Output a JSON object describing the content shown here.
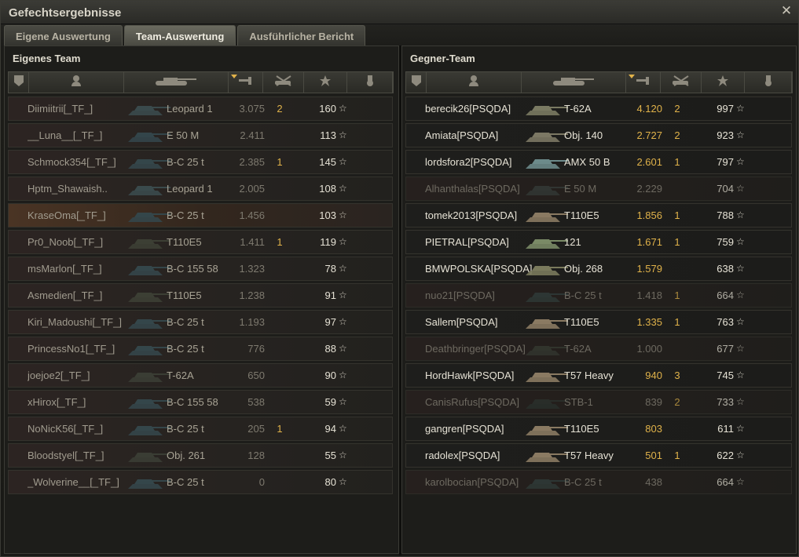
{
  "window": {
    "title": "Gefechtsergebnisse"
  },
  "tabs": [
    {
      "label": "Eigene Auswertung",
      "active": false
    },
    {
      "label": "Team-Auswertung",
      "active": true
    },
    {
      "label": "Ausführlicher Bericht",
      "active": false
    }
  ],
  "columns": [
    "squad-icon",
    "player-icon",
    "tank-icon",
    "experience-icon",
    "kills-icon",
    "score-icon",
    "medal-icon"
  ],
  "own_team": {
    "title": "Eigenes Team",
    "players": [
      {
        "name": "Diimiitrii[_TF_]",
        "tank": "Leopard 1",
        "xp": "3.075",
        "kills": "2",
        "score": "160",
        "dead": false,
        "self": false,
        "tank_color": "#3a4a4c"
      },
      {
        "name": "__Luna__[_TF_]",
        "tank": "E 50 M",
        "xp": "2.411",
        "kills": "",
        "score": "113",
        "dead": false,
        "self": false,
        "tank_color": "#33454a"
      },
      {
        "name": "Schmock354[_TF_]",
        "tank": "B-C 25 t",
        "xp": "2.385",
        "kills": "1",
        "score": "145",
        "dead": false,
        "self": false,
        "tank_color": "#34464a"
      },
      {
        "name": "Hptm_Shawaish..",
        "tank": "Leopard 1",
        "xp": "2.005",
        "kills": "",
        "score": "108",
        "dead": false,
        "self": false,
        "tank_color": "#3a4a4c"
      },
      {
        "name": "KraseOma[_TF_]",
        "tank": "B-C 25 t",
        "xp": "1.456",
        "kills": "",
        "score": "103",
        "dead": false,
        "self": true,
        "tank_color": "#34464a"
      },
      {
        "name": "Pr0_Noob[_TF_]",
        "tank": "T110E5",
        "xp": "1.411",
        "kills": "1",
        "score": "119",
        "dead": false,
        "self": false,
        "tank_color": "#3c3f34"
      },
      {
        "name": "msMarlon[_TF_]",
        "tank": "B-C 155 58",
        "xp": "1.323",
        "kills": "",
        "score": "78",
        "dead": false,
        "self": false,
        "tank_color": "#34464a"
      },
      {
        "name": "Asmedien[_TF_]",
        "tank": "T110E5",
        "xp": "1.238",
        "kills": "",
        "score": "91",
        "dead": false,
        "self": false,
        "tank_color": "#3c3f34"
      },
      {
        "name": "Kiri_Madoushi[_TF_]",
        "tank": "B-C 25 t",
        "xp": "1.193",
        "kills": "",
        "score": "97",
        "dead": false,
        "self": false,
        "tank_color": "#34464a"
      },
      {
        "name": "PrincessNo1[_TF_]",
        "tank": "B-C 25 t",
        "xp": "776",
        "kills": "",
        "score": "88",
        "dead": false,
        "self": false,
        "tank_color": "#34464a"
      },
      {
        "name": "joejoe2[_TF_]",
        "tank": "T-62A",
        "xp": "650",
        "kills": "",
        "score": "90",
        "dead": false,
        "self": false,
        "tank_color": "#3a3d34"
      },
      {
        "name": "xHirox[_TF_]",
        "tank": "B-C 155 58",
        "xp": "538",
        "kills": "",
        "score": "59",
        "dead": false,
        "self": false,
        "tank_color": "#34464a"
      },
      {
        "name": "NoNicK56[_TF_]",
        "tank": "B-C 25 t",
        "xp": "205",
        "kills": "1",
        "score": "94",
        "dead": false,
        "self": false,
        "tank_color": "#34464a"
      },
      {
        "name": "Bloodstyel[_TF_]",
        "tank": "Obj. 261",
        "xp": "128",
        "kills": "",
        "score": "55",
        "dead": false,
        "self": false,
        "tank_color": "#3a3d34"
      },
      {
        "name": "_Wolverine__[_TF_]",
        "tank": "B-C 25 t",
        "xp": "0",
        "kills": "",
        "score": "80",
        "dead": false,
        "self": false,
        "tank_color": "#34464a"
      }
    ]
  },
  "enemy_team": {
    "title": "Gegner-Team",
    "players": [
      {
        "name": "berecik26[PSQDA]",
        "tank": "T-62A",
        "xp": "4.120",
        "kills": "2",
        "score": "997",
        "dead": false,
        "tank_color": "#7a7a62"
      },
      {
        "name": "Amiata[PSQDA]",
        "tank": "Obj. 140",
        "xp": "2.727",
        "kills": "2",
        "score": "923",
        "dead": false,
        "tank_color": "#7c7864"
      },
      {
        "name": "lordsfora2[PSQDA]",
        "tank": "AMX 50 B",
        "xp": "2.601",
        "kills": "1",
        "score": "797",
        "dead": false,
        "tank_color": "#6c8a8a"
      },
      {
        "name": "Alhanthalas[PSQDA]",
        "tank": "E 50 M",
        "xp": "2.229",
        "kills": "",
        "score": "704",
        "dead": true,
        "tank_color": "#3a3f3c"
      },
      {
        "name": "tomek2013[PSQDA]",
        "tank": "T110E5",
        "xp": "1.856",
        "kills": "1",
        "score": "788",
        "dead": false,
        "tank_color": "#8a7a62"
      },
      {
        "name": "PIETRAL[PSQDA]",
        "tank": "121",
        "xp": "1.671",
        "kills": "1",
        "score": "759",
        "dead": false,
        "tank_color": "#7a8a66"
      },
      {
        "name": "BMWPOLSKA[PSQDA]",
        "tank": "Obj. 268",
        "xp": "1.579",
        "kills": "",
        "score": "638",
        "dead": false,
        "tank_color": "#7a7a5c"
      },
      {
        "name": "nuo21[PSQDA]",
        "tank": "B-C 25 t",
        "xp": "1.418",
        "kills": "1",
        "score": "664",
        "dead": true,
        "tank_color": "#34403e"
      },
      {
        "name": "Sallem[PSQDA]",
        "tank": "T110E5",
        "xp": "1.335",
        "kills": "1",
        "score": "763",
        "dead": false,
        "tank_color": "#8a7a62"
      },
      {
        "name": "Deathbringer[PSQDA]",
        "tank": "T-62A",
        "xp": "1.000",
        "kills": "",
        "score": "677",
        "dead": true,
        "tank_color": "#3a3d34"
      },
      {
        "name": "HordHawk[PSQDA]",
        "tank": "T57 Heavy",
        "xp": "940",
        "kills": "3",
        "score": "745",
        "dead": false,
        "tank_color": "#8a7a62"
      },
      {
        "name": "CanisRufus[PSQDA]",
        "tank": "STB-1",
        "xp": "839",
        "kills": "2",
        "score": "733",
        "dead": true,
        "tank_color": "#2e3430"
      },
      {
        "name": "gangren[PSQDA]",
        "tank": "T110E5",
        "xp": "803",
        "kills": "",
        "score": "611",
        "dead": false,
        "tank_color": "#8a7a62"
      },
      {
        "name": "radolex[PSQDA]",
        "tank": "T57 Heavy",
        "xp": "501",
        "kills": "1",
        "score": "622",
        "dead": false,
        "tank_color": "#8a7a62"
      },
      {
        "name": "karolbocian[PSQDA]",
        "tank": "B-C 25 t",
        "xp": "438",
        "kills": "",
        "score": "664",
        "dead": true,
        "tank_color": "#34403e"
      }
    ]
  }
}
